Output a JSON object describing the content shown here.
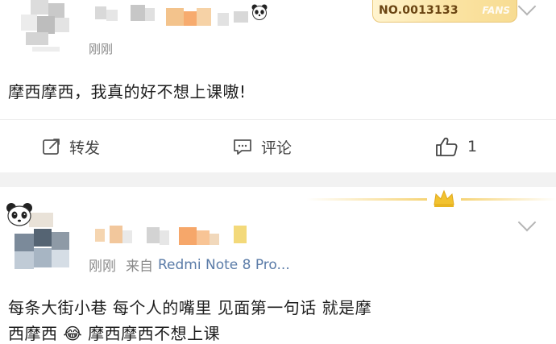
{
  "post1": {
    "username": "",
    "time": "刚刚",
    "badge_number": "NO.0013133",
    "badge_label": "FANS",
    "content": "摩西摩西，我真的好不想上课嗷!",
    "actions": {
      "repost_label": "转发",
      "comment_label": "评论",
      "like_count": "1"
    }
  },
  "post2": {
    "username": "",
    "time": "刚刚",
    "from_label": "来自",
    "device": "Redmi Note 8 Pro...",
    "content_line1": "每条大街小巷 每个人的嘴里 见面第一句话 就是摩",
    "content_line2": "西摩西 😂 摩西摩西不想上课"
  },
  "colors": {
    "link_blue": "#5b7ca8",
    "badge_gold": "#f7dc92",
    "crown_gold": "#f2c230",
    "muted_gray": "#8a8a8a"
  },
  "icons": [
    "panda-icon",
    "chevron-down-icon",
    "repost-icon",
    "comment-icon",
    "like-icon",
    "crown-icon",
    "laugh-emoji-icon"
  ]
}
